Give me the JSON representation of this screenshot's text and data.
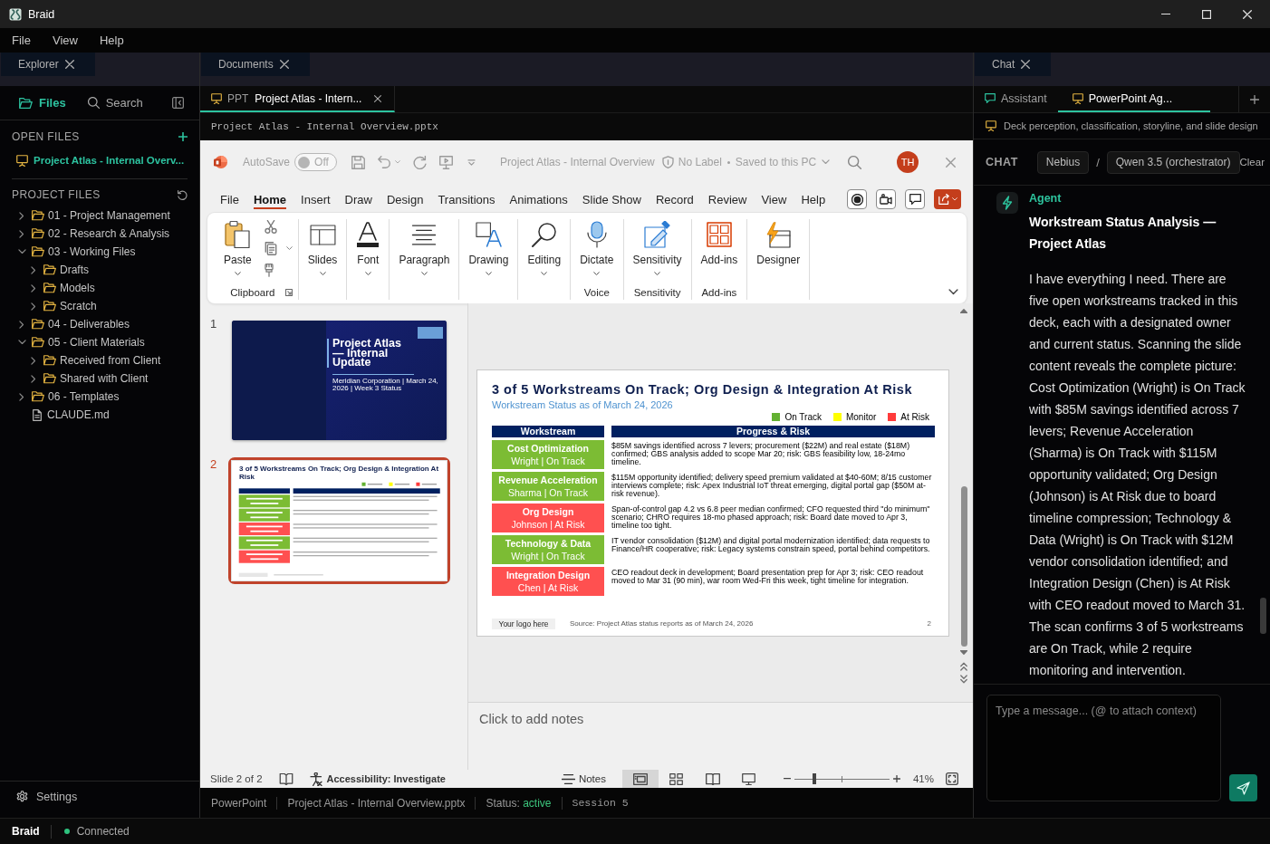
{
  "window": {
    "title": "Braid"
  },
  "menu": [
    "File",
    "View",
    "Help"
  ],
  "explorer": {
    "panel_tab": "Explorer",
    "view_tabs": [
      {
        "label": "Files",
        "kind": "files",
        "selected": true
      },
      {
        "label": "Search",
        "kind": "search",
        "selected": false
      }
    ],
    "open_files": {
      "heading": "OPEN FILES",
      "items": [
        {
          "label": "Project Atlas - Internal Overv...",
          "selected": true
        }
      ]
    },
    "project_files": {
      "heading": "PROJECT FILES",
      "tree": [
        {
          "label": "01 - Project Management",
          "kind": "folder",
          "expanded": false
        },
        {
          "label": "02 - Research & Analysis",
          "kind": "folder",
          "expanded": false
        },
        {
          "label": "03 - Working Files",
          "kind": "folder",
          "expanded": true,
          "children": [
            {
              "label": "Drafts",
              "kind": "folder",
              "expanded": false
            },
            {
              "label": "Models",
              "kind": "folder",
              "expanded": false
            },
            {
              "label": "Scratch",
              "kind": "folder",
              "expanded": false
            }
          ]
        },
        {
          "label": "04 - Deliverables",
          "kind": "folder",
          "expanded": false
        },
        {
          "label": "05 - Client Materials",
          "kind": "folder",
          "expanded": true,
          "children": [
            {
              "label": "Received from Client",
              "kind": "folder",
              "expanded": false
            },
            {
              "label": "Shared with Client",
              "kind": "folder",
              "expanded": false
            }
          ]
        },
        {
          "label": "06 - Templates",
          "kind": "folder",
          "expanded": false
        },
        {
          "label": "CLAUDE.md",
          "kind": "file"
        }
      ]
    },
    "settings": "Settings"
  },
  "documents": {
    "panel_tab": "Documents",
    "doc_tabs": [
      {
        "type": "PPT",
        "label": "Project Atlas - Intern...",
        "selected": true
      }
    ],
    "path": "Project Atlas - Internal Overview.pptx",
    "powerpoint": {
      "autosave": {
        "label": "AutoSave",
        "state": "Off",
        "on": false
      },
      "title": "Project Atlas - Internal Overview",
      "sensitivity": "No Label",
      "save_status": "Saved to this PC",
      "avatar": "TH",
      "ribbon_tabs": [
        {
          "label": "File",
          "selected": false
        },
        {
          "label": "Home",
          "selected": true
        },
        {
          "label": "Insert",
          "selected": false
        },
        {
          "label": "Draw",
          "selected": false
        },
        {
          "label": "Design",
          "selected": false
        },
        {
          "label": "Transitions",
          "selected": false
        },
        {
          "label": "Animations",
          "selected": false
        },
        {
          "label": "Slide Show",
          "selected": false
        },
        {
          "label": "Record",
          "selected": false
        },
        {
          "label": "Review",
          "selected": false
        },
        {
          "label": "View",
          "selected": false
        },
        {
          "label": "Help",
          "selected": false
        }
      ],
      "ribbon_groups": [
        {
          "kind": "paste",
          "button": "Paste",
          "dropdown": true,
          "label": "Clipboard"
        },
        {
          "kind": "slides",
          "button": "Slides",
          "dropdown": true
        },
        {
          "kind": "font",
          "button": "Font",
          "dropdown": true
        },
        {
          "kind": "paragraph",
          "button": "Paragraph",
          "dropdown": true
        },
        {
          "kind": "drawing",
          "button": "Drawing",
          "dropdown": true
        },
        {
          "kind": "editing",
          "button": "Editing",
          "dropdown": true
        },
        {
          "kind": "dictate",
          "button": "Dictate",
          "dropdown": true,
          "label": "Voice"
        },
        {
          "kind": "sensitivity",
          "button": "Sensitivity",
          "dropdown": true,
          "label": "Sensitivity"
        },
        {
          "kind": "addins",
          "button": "Add-ins",
          "dropdown": false,
          "label": "Add-ins"
        },
        {
          "kind": "designer",
          "button": "Designer",
          "dropdown": false
        }
      ],
      "thumbnails": [
        {
          "number": "1",
          "kind": "title",
          "selected": false,
          "title": "Project Atlas — Internal Update",
          "subtitle": "Meridian Corporation | March 24, 2026 | Week 3 Status"
        },
        {
          "number": "2",
          "kind": "table",
          "selected": true,
          "title": "3 of 5 Workstreams On Track; Org Design & Integration At Risk"
        }
      ],
      "slide": {
        "title": "3 of 5 Workstreams On Track; Org Design & Integration At Risk",
        "subtitle": "Workstream Status as of March 24, 2026",
        "legend": [
          {
            "label": "On Track",
            "color": "#63b132"
          },
          {
            "label": "Monitor",
            "color": "#ffff00"
          },
          {
            "label": "At Risk",
            "color": "#ff3b3b"
          }
        ],
        "columns": [
          "Workstream",
          "Progress & Risk"
        ],
        "rows": [
          {
            "name": "Cost Optimization",
            "owner_status": "Wright | On Track",
            "color": "#7cbc34",
            "progress": "$85M savings identified across 7 levers; procurement ($22M) and real estate ($18M) confirmed; GBS analysis added to scope Mar 20; risk: GBS feasibility low, 18-24mo timeline."
          },
          {
            "name": "Revenue Acceleration",
            "owner_status": "Sharma | On Track",
            "color": "#7cbc34",
            "progress": "$115M opportunity identified; delivery speed premium validated at $40-60M; 8/15 customer interviews complete; risk: Apex Industrial IoT threat emerging, digital portal gap ($50M at-risk revenue)."
          },
          {
            "name": "Org Design",
            "owner_status": "Johnson | At Risk",
            "color": "#ff5050",
            "progress": "Span-of-control gap 4.2 vs 6.8 peer median confirmed; CFO requested third \"do minimum\" scenario; CHRO requires 18-mo phased approach; risk: Board date moved to Apr 3, timeline too tight."
          },
          {
            "name": "Technology & Data",
            "owner_status": "Wright | On Track",
            "color": "#7cbc34",
            "progress": "IT vendor consolidation ($12M) and digital portal modernization identified; data requests to Finance/HR cooperative; risk: Legacy systems constrain speed, portal behind competitors."
          },
          {
            "name": "Integration Design",
            "owner_status": "Chen | At Risk",
            "color": "#ff5050",
            "progress": "CEO readout deck in development; Board presentation prep for Apr 3; risk: CEO readout moved to Mar 31 (90 min), war room Wed-Fri this week, tight timeline for integration."
          }
        ],
        "footer": {
          "logo": "Your logo here",
          "source": "Source: Project Atlas status reports as of March 24, 2026",
          "page": "2"
        }
      },
      "notes_placeholder": "Click to add notes",
      "status_bar": {
        "slide_counter": "Slide 2 of 2",
        "accessibility": "Accessibility: Investigate",
        "notes": "Notes",
        "views": [
          {
            "kind": "normal",
            "selected": true
          },
          {
            "kind": "sorter",
            "selected": false
          },
          {
            "kind": "reading",
            "selected": false
          },
          {
            "kind": "slideshow",
            "selected": false
          }
        ],
        "zoom": {
          "level": 0.21,
          "reading": "41%"
        }
      }
    },
    "app_status": {
      "app": "PowerPoint",
      "file": "Project Atlas - Internal Overview.pptx",
      "status_label": "Status:",
      "status_value": "active",
      "session": "Session 5"
    }
  },
  "chat": {
    "panel_tab": "Chat",
    "tabs": [
      {
        "label": "Assistant",
        "kind": "chat",
        "selected": false
      },
      {
        "label": "PowerPoint Ag...",
        "kind": "presentation",
        "selected": true
      }
    ],
    "description": "Deck perception, classification, storyline, and slide design",
    "header": {
      "section": "CHAT",
      "provider": "Nebius",
      "separator": "/",
      "model": "Qwen 3.5 (orchestrator)",
      "action": "Clear"
    },
    "messages": [
      {
        "author": "Agent",
        "title": "Workstream Status Analysis — Project Atlas",
        "body": "I have everything I need. There are five open workstreams tracked in this deck, each with a designated owner and current status. Scanning the slide content reveals the complete picture: Cost Optimization (Wright) is On Track with $85M savings identified across 7 levers; Revenue Acceleration (Sharma) is On Track with $115M opportunity validated; Org Design (Johnson) is At Risk due to board timeline compression; Technology & Data (Wright) is On Track with $12M vendor consolidation identified; and Integration Design (Chen) is At Risk with CEO readout moved to March 31. The scan confirms 3 of 5 workstreams are On Track, while 2 require monitoring and intervention."
      }
    ],
    "input": {
      "placeholder": "Type a message... (@ to attach context)"
    }
  },
  "status_bar": {
    "app": "Braid",
    "connection": {
      "label": "Connected",
      "online": true
    }
  }
}
